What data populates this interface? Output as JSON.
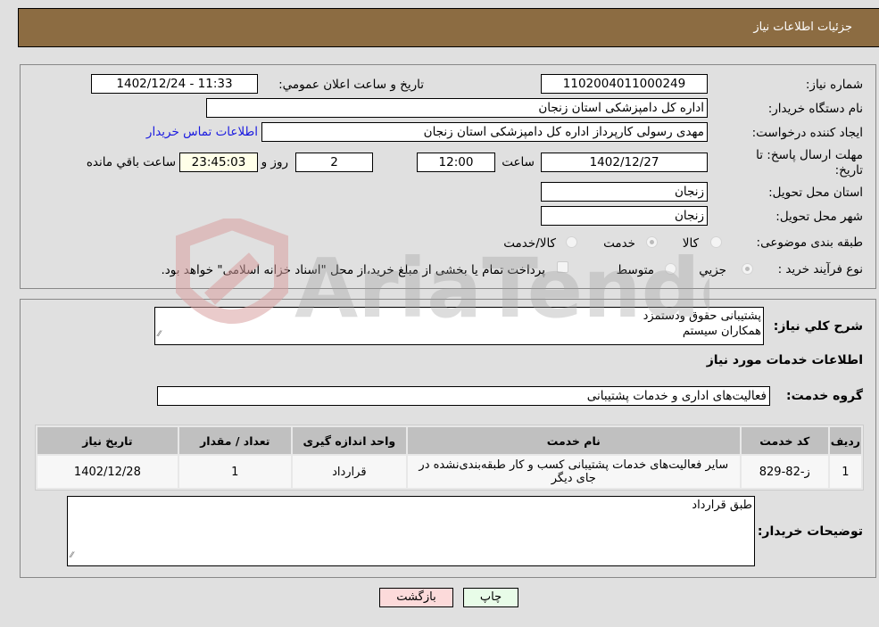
{
  "header": {
    "title": "جزئیات اطلاعات نیاز"
  },
  "details": {
    "need_number_label": "شماره نیاز:",
    "need_number": "1102004011000249",
    "announce_label": "تاریخ و ساعت اعلان عمومي:",
    "announce_value": "1402/12/24 - 11:33",
    "buyer_org_label": "نام دستگاه خریدار:",
    "buyer_org": "اداره کل دامپزشکی استان زنجان",
    "creator_label": "ایجاد کننده درخواست:",
    "creator": "مهدی رسولی کارپرداز اداره کل دامپزشکی استان زنجان",
    "contact_link": "اطلاعات تماس خریدار",
    "deadline_label": "مهلت ارسال پاسخ: تا تاریخ:",
    "deadline_date": "1402/12/27",
    "time_label": "ساعت",
    "deadline_time": "12:00",
    "days_value": "2",
    "days_label": "روز و",
    "remaining_time": "23:45:03",
    "remaining_label": "ساعت باقي مانده",
    "province_label": "استان محل تحویل:",
    "province": "زنجان",
    "city_label": "شهر محل تحویل:",
    "city": "زنجان",
    "category_label": "طبقه بندی موضوعی:",
    "category_options": [
      {
        "label": "کالا",
        "selected": false
      },
      {
        "label": "خدمت",
        "selected": true
      },
      {
        "label": "کالا/خدمت",
        "selected": false
      }
    ],
    "process_label": "نوع فرآیند خرید :",
    "process_options": [
      {
        "label": "جزيي",
        "selected": true
      },
      {
        "label": "متوسط",
        "selected": false
      }
    ],
    "treasury_note": "پرداخت تمام یا بخشی از مبلغ خرید،از محل \"اسناد خزانه اسلامی\" خواهد بود.",
    "treasury_checked": false
  },
  "summary": {
    "desc_label": "شرح کلي نیاز:",
    "desc_line1": "پشتیبانی حقوق ودستمزد",
    "desc_line2": "همکاران سیستم",
    "services_heading": "اطلاعات خدمات مورد نیاز",
    "group_label": "گروه خدمت:",
    "group_value": "فعالیت‌های اداری و خدمات پشتیبانی"
  },
  "table": {
    "headers": [
      "ردیف",
      "کد خدمت",
      "نام خدمت",
      "واحد اندازه گیری",
      "تعداد / مقدار",
      "تاریخ نیاز"
    ],
    "rows": [
      {
        "row": "1",
        "code": "ز-82-829",
        "name": "سایر فعالیت‌های خدمات پشتیبانی کسب و کار طبقه‌بندی‌نشده در جای دیگر",
        "unit": "قرارداد",
        "qty": "1",
        "date": "1402/12/28"
      }
    ]
  },
  "buyer_notes": {
    "label": "توضیحات خریدار:",
    "value": "طبق قرارداد"
  },
  "buttons": {
    "print": "چاپ",
    "back": "بازگشت"
  },
  "watermark": {
    "text": "AriaTender.neT"
  }
}
